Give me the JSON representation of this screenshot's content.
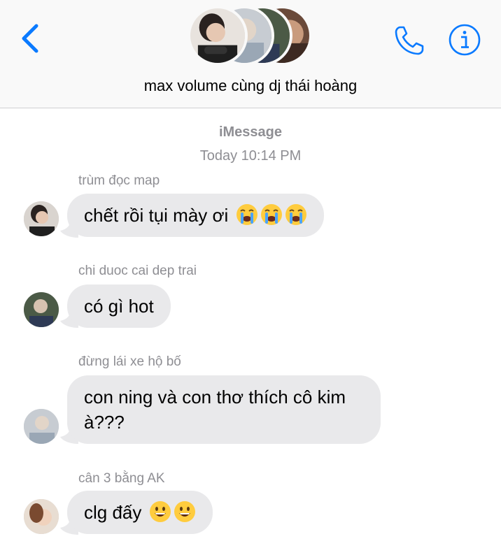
{
  "header": {
    "group_title": "max volume cùng dj thái hoàng",
    "back_icon": "chevron-left-icon",
    "call_icon": "phone-icon",
    "info_icon": "info-icon",
    "accent_color": "#0a7aff"
  },
  "thread": {
    "service": "iMessage",
    "timestamp": "Today 10:14 PM"
  },
  "messages": [
    {
      "sender": "trùm đọc map",
      "text": "chết rồi tụi mày ơi",
      "emoji": [
        "crying-face",
        "crying-face",
        "crying-face"
      ]
    },
    {
      "sender": "chi duoc cai dep trai",
      "text": "có gì hot",
      "emoji": []
    },
    {
      "sender": "đừng lái xe hộ bố",
      "text_line1": "con ning và con thơ thích cô kim",
      "text_line2": "à???",
      "emoji": []
    },
    {
      "sender": "cân 3 bằng AK",
      "text": "clg đấy",
      "emoji": [
        "grinning-face",
        "grinning-face"
      ]
    }
  ],
  "colors": {
    "bubble_received": "#e9e9eb",
    "meta_text": "#8e8e93"
  }
}
